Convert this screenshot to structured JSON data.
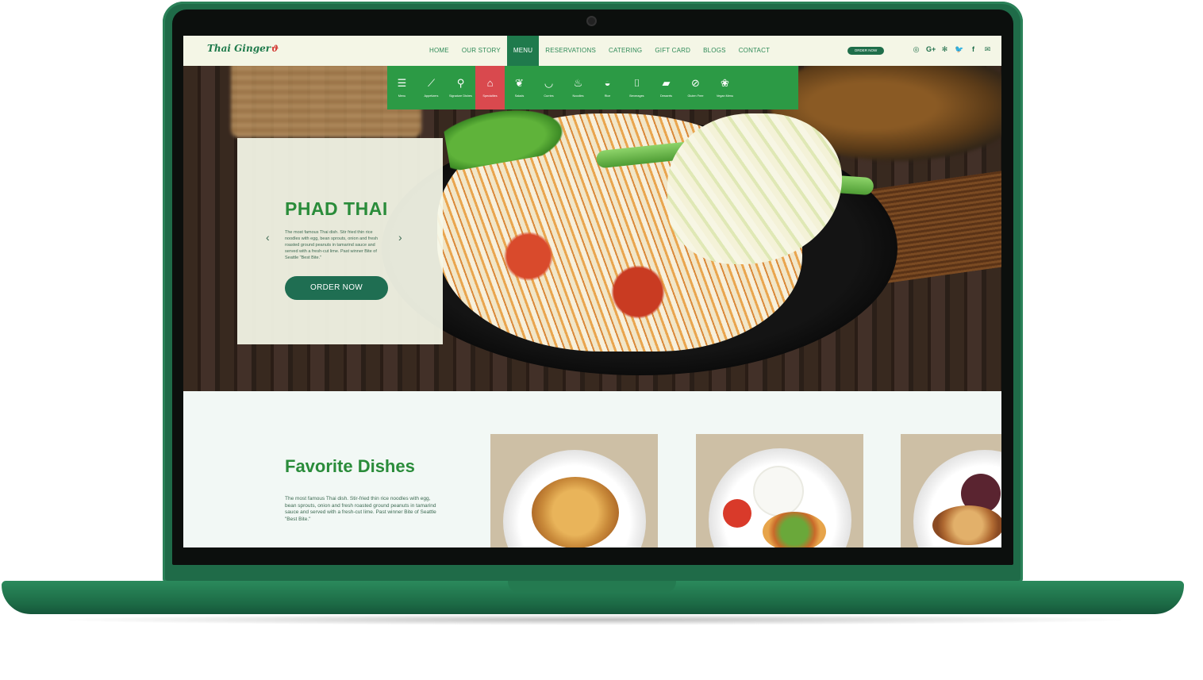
{
  "brand": {
    "logo_text": "Thai Ginger"
  },
  "nav": {
    "items": [
      {
        "label": "HOME",
        "active": false
      },
      {
        "label": "OUR STORY",
        "active": false
      },
      {
        "label": "MENU",
        "active": true
      },
      {
        "label": "RESERVATIONS",
        "active": false
      },
      {
        "label": "CATERING",
        "active": false
      },
      {
        "label": "GIFT CARD",
        "active": false
      },
      {
        "label": "BLOGS",
        "active": false
      },
      {
        "label": "CONTACT",
        "active": false
      }
    ],
    "order_now": "ORDER NOW",
    "social": [
      {
        "icon": "instagram-icon",
        "glyph": "◎"
      },
      {
        "icon": "google-plus-icon",
        "glyph": "G+"
      },
      {
        "icon": "yelp-icon",
        "glyph": "✻"
      },
      {
        "icon": "twitter-icon",
        "glyph": "🐦"
      },
      {
        "icon": "facebook-icon",
        "glyph": "f"
      },
      {
        "icon": "mail-icon",
        "glyph": "✉"
      }
    ]
  },
  "categories": [
    {
      "label": "Menu",
      "icon": "menu-icon",
      "glyph": "☰"
    },
    {
      "label": "Appetizers",
      "icon": "skewer-icon",
      "glyph": "⟋"
    },
    {
      "label": "Signature Dishes",
      "icon": "fork-knife-icon",
      "glyph": "⚲"
    },
    {
      "label": "Specialties",
      "icon": "cloche-icon",
      "glyph": "⌂",
      "active": true
    },
    {
      "label": "Salads",
      "icon": "leaf-icon",
      "glyph": "❦"
    },
    {
      "label": "Curries",
      "icon": "bowl-icon",
      "glyph": "◡"
    },
    {
      "label": "Noodles",
      "icon": "noodles-icon",
      "glyph": "♨"
    },
    {
      "label": "Rice",
      "icon": "rice-bowl-icon",
      "glyph": "◒"
    },
    {
      "label": "Beverages",
      "icon": "drink-icon",
      "glyph": "⌷"
    },
    {
      "label": "Desserts",
      "icon": "cake-icon",
      "glyph": "▰"
    },
    {
      "label": "Gluten Free",
      "icon": "gluten-free-icon",
      "glyph": "⊘"
    },
    {
      "label": "Vegan Menu",
      "icon": "vegan-icon",
      "glyph": "❀"
    }
  ],
  "hero": {
    "title": "PHAD THAI",
    "description": "The most famous Thai dish. Stir fried thin rice noodles with egg, bean sprouts, onion and fresh roasted ground peanuts in tamarind sauce and served with a fresh-cut lime. Past winner Bite of Seattle \"Best Bite.\"",
    "button": "ORDER NOW",
    "prev_glyph": "‹",
    "next_glyph": "›"
  },
  "favorites": {
    "title": "Favorite Dishes",
    "description": "The most famous Thai dish. Stir-fried thin rice noodles with egg, bean sprouts, onion and fresh roasted ground peanuts in tamarind sauce and served with a fresh-cut lime. Past winner Bite of Seattle \"Best Bite.\""
  },
  "colors": {
    "brand_green": "#1f6e4a",
    "accent_green": "#2c9a45",
    "active_red": "#d9494e",
    "title_green": "#2a8c3a"
  }
}
